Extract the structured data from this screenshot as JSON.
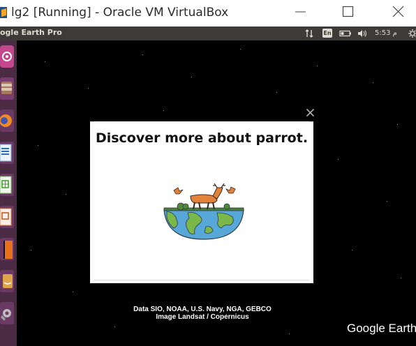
{
  "window": {
    "title": "lg2 [Running] - Oracle VM VirtualBox",
    "icon": "virtualbox-icon",
    "controls": [
      "minimize-icon",
      "maximize-icon",
      "close-icon"
    ]
  },
  "panel": {
    "app_title": "ogle Earth Pro",
    "keyboard_layout": "En",
    "clock": "م 5:53",
    "indicators": [
      "network-icon",
      "keyboard-icon",
      "battery-icon",
      "volume-icon",
      "clock",
      "power-icon"
    ]
  },
  "launcher": {
    "items": [
      "ubuntu-dash-icon",
      "files-icon",
      "firefox-icon",
      "writer-icon",
      "calc-icon",
      "impress-icon",
      "software-center-icon",
      "amazon-icon",
      "settings-icon"
    ]
  },
  "dialog": {
    "title": "Discover more about parrot.",
    "close_icon": "close-icon",
    "illustration": "deer-on-globe-illustration"
  },
  "attribution": {
    "line1": "Data SIO, NOAA, U.S. Navy, NGA, GEBCO",
    "line2": "Image Landsat / Copernicus"
  },
  "logo": {
    "text": "Google Earth"
  },
  "colors": {
    "panel": "#3c3b37",
    "launcher": "#4b2b44",
    "space": "#000000",
    "dialog": "#ffffff"
  }
}
